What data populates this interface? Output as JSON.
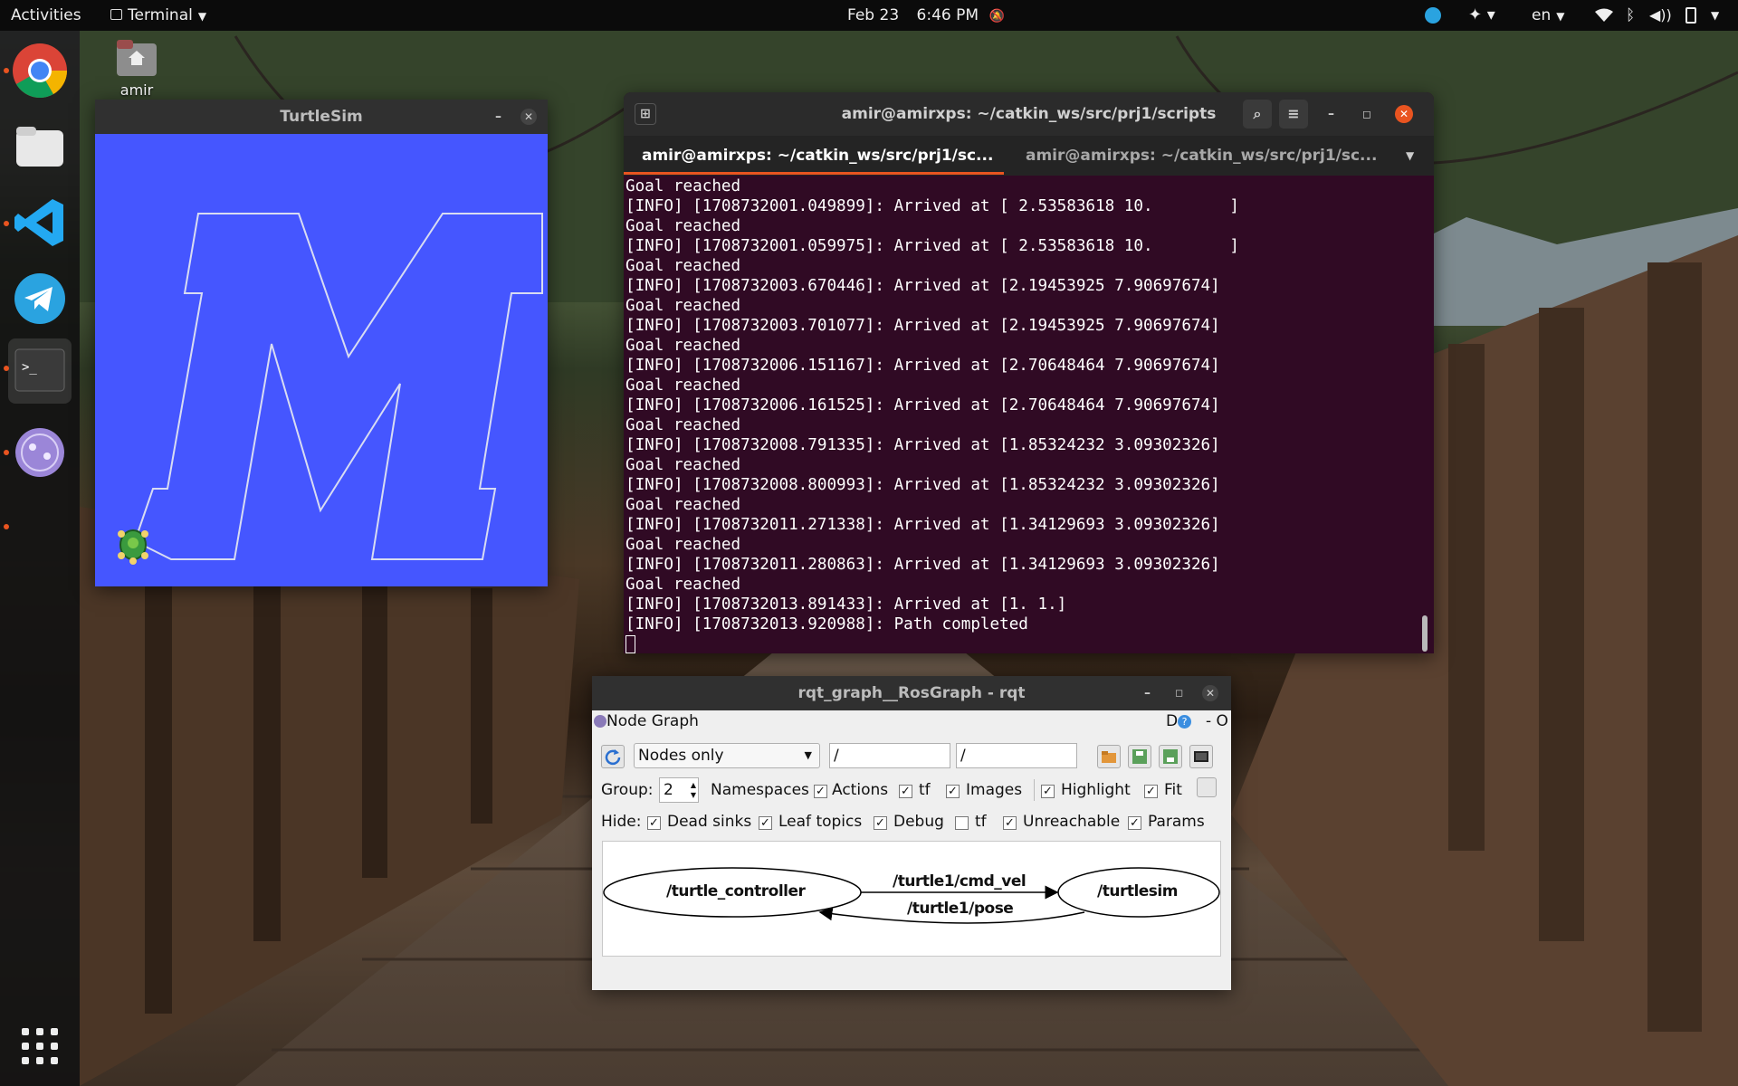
{
  "topbar": {
    "activities": "Activities",
    "app_menu": "Terminal",
    "date": "Feb 23",
    "time": "6:46 PM",
    "language": "en"
  },
  "dock": {
    "items": [
      "chrome-icon",
      "files-icon",
      "vscode-icon",
      "telegram-icon",
      "terminal-icon",
      "app-icon"
    ],
    "show_apps": "show-apps-icon"
  },
  "desktop": {
    "home_label": "amir"
  },
  "turtlesim": {
    "title": "TurtleSim"
  },
  "terminal": {
    "title": "amir@amirxps: ~/catkin_ws/src/prj1/scripts",
    "tabs": [
      {
        "label": "amir@amirxps: ~/catkin_ws/src/prj1/sc...",
        "active": true
      },
      {
        "label": "amir@amirxps: ~/catkin_ws/src/prj1/sc...",
        "active": false
      }
    ],
    "lines": [
      "Goal reached",
      "[INFO] [1708732001.049899]: Arrived at [ 2.53583618 10.        ]",
      "Goal reached",
      "[INFO] [1708732001.059975]: Arrived at [ 2.53583618 10.        ]",
      "Goal reached",
      "[INFO] [1708732003.670446]: Arrived at [2.19453925 7.90697674]",
      "Goal reached",
      "[INFO] [1708732003.701077]: Arrived at [2.19453925 7.90697674]",
      "Goal reached",
      "[INFO] [1708732006.151167]: Arrived at [2.70648464 7.90697674]",
      "Goal reached",
      "[INFO] [1708732006.161525]: Arrived at [2.70648464 7.90697674]",
      "Goal reached",
      "[INFO] [1708732008.791335]: Arrived at [1.85324232 3.09302326]",
      "Goal reached",
      "[INFO] [1708732008.800993]: Arrived at [1.85324232 3.09302326]",
      "Goal reached",
      "[INFO] [1708732011.271338]: Arrived at [1.34129693 3.09302326]",
      "Goal reached",
      "[INFO] [1708732011.280863]: Arrived at [1.34129693 3.09302326]",
      "Goal reached",
      "[INFO] [1708732013.891433]: Arrived at [1. 1.]",
      "[INFO] [1708732013.920988]: Path completed"
    ]
  },
  "rqt": {
    "title": "rqt_graph__RosGraph - rqt",
    "plugin_title": "Node Graph",
    "plugin_controls": "D",
    "plugin_minus": "- O",
    "mode_select": "Nodes only",
    "filter_in": "/",
    "filter_out": "/",
    "group_label": "Group:",
    "group_value": "2",
    "namespaces_label": "Namespaces",
    "row1": [
      {
        "label": "Actions",
        "checked": true
      },
      {
        "label": "tf",
        "checked": true
      },
      {
        "label": "Images",
        "checked": true
      },
      {
        "label": "Highlight",
        "checked": true
      },
      {
        "label": "Fit",
        "checked": true
      }
    ],
    "hide_label": "Hide:",
    "row2": [
      {
        "label": "Dead sinks",
        "checked": true
      },
      {
        "label": "Leaf topics",
        "checked": true
      },
      {
        "label": "Debug",
        "checked": true
      },
      {
        "label": "tf",
        "checked": false
      },
      {
        "label": "Unreachable",
        "checked": true
      },
      {
        "label": "Params",
        "checked": true
      }
    ],
    "graph": {
      "node_controller": "/turtle_controller",
      "node_sim": "/turtlesim",
      "topic_cmd": "/turtle1/cmd_vel",
      "topic_pose": "/turtle1/pose"
    }
  },
  "colors": {
    "turtle_bg": "#4556ff",
    "terminal_bg": "#300a24",
    "accent": "#e95420"
  }
}
